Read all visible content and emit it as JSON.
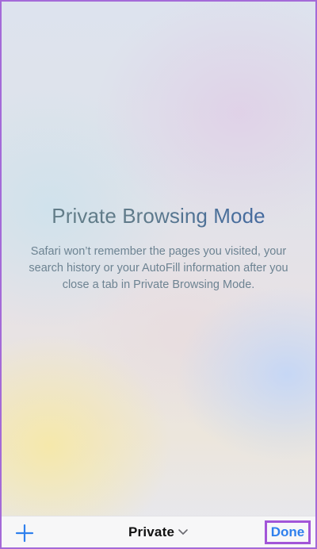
{
  "private_page": {
    "title": "Private Browsing Mode",
    "description": "Safari won’t remember the pages you visited, your search history or your AutoFill information after you close a tab in Private Browsing Mode."
  },
  "toolbar": {
    "new_tab_icon": "plus-icon",
    "tab_group_label": "Private",
    "tab_group_icon": "chevron-down-icon",
    "done_label": "Done"
  },
  "colors": {
    "accent": "#2f80ed",
    "highlight_border": "#a255d8",
    "title_gradient_start": "#647e86",
    "title_gradient_end": "#3d63a4"
  }
}
